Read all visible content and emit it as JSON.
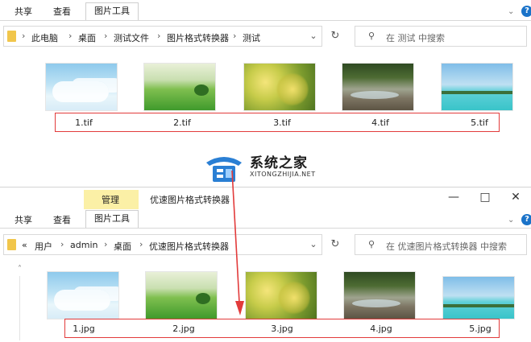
{
  "top_window": {
    "ribbon_tabs": [
      "共享",
      "查看",
      "图片工具"
    ],
    "breadcrumb": [
      "此电脑",
      "桌面",
      "测试文件",
      "图片格式转换器",
      "测试"
    ],
    "search_placeholder": "在 测试 中搜索",
    "files": [
      {
        "name": "1.tif",
        "icon": "sky-clouds-thumbnail"
      },
      {
        "name": "2.tif",
        "icon": "green-field-thumbnail"
      },
      {
        "name": "3.tif",
        "icon": "yellow-flowers-thumbnail"
      },
      {
        "name": "4.tif",
        "icon": "river-rocks-thumbnail"
      },
      {
        "name": "5.tif",
        "icon": "beach-thumbnail"
      }
    ]
  },
  "watermark": {
    "name": "系统之家",
    "url": "XITONGZHIJIA.NET"
  },
  "bottom_window": {
    "context_tab": "管理",
    "window_title": "优速图片格式转换器",
    "ribbon_tabs": [
      "共享",
      "查看",
      "图片工具"
    ],
    "breadcrumb_prefix": "«",
    "breadcrumb": [
      "用户",
      "admin",
      "桌面",
      "优速图片格式转换器"
    ],
    "search_placeholder": "在 优速图片格式转换器 中搜索",
    "files": [
      {
        "name": "1.jpg",
        "icon": "sky-clouds-thumbnail"
      },
      {
        "name": "2.jpg",
        "icon": "green-field-thumbnail"
      },
      {
        "name": "3.jpg",
        "icon": "yellow-flowers-thumbnail"
      },
      {
        "name": "4.jpg",
        "icon": "river-rocks-thumbnail"
      },
      {
        "name": "5.jpg",
        "icon": "beach-thumbnail"
      }
    ]
  },
  "colors": {
    "annotation_red": "#e23b3b",
    "context_band": "#fbf0a6",
    "help_blue": "#1a73c9"
  }
}
